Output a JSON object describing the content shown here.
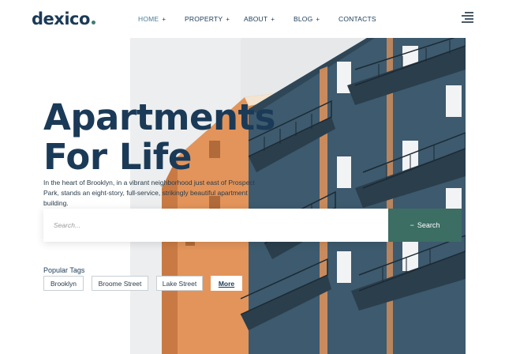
{
  "header": {
    "logo": "dexico",
    "nav": [
      {
        "label": "HOME",
        "has_submenu": true,
        "active": true
      },
      {
        "label": "PROPERTY",
        "has_submenu": true
      },
      {
        "label": "ABOUT",
        "has_submenu": true
      },
      {
        "label": "BLOG",
        "has_submenu": true
      },
      {
        "label": "CONTACTS",
        "has_submenu": false
      }
    ],
    "menu_icon": "hamburger-menu-icon",
    "submenu_marker": "+"
  },
  "hero": {
    "headline_line1": "Apartments",
    "headline_line2": "For Life",
    "description": "In the heart of Brooklyn, in a vibrant neighborhood just east of Prospect Park, stands an eight-story, full-service, strikingly beautiful apartment building."
  },
  "search": {
    "placeholder": "Search...",
    "value": "",
    "button_label": "Search",
    "button_icon": "minus-icon"
  },
  "tags": {
    "label": "Popular Tags",
    "items": [
      "Brooklyn",
      "Broome Street",
      "Lake Street"
    ],
    "more_label": "More"
  },
  "colors": {
    "brand": "#1b3a57",
    "accent": "#3c6e64",
    "nav_active": "#4a7c96",
    "building_blue": "#3d5a6e",
    "building_orange": "#e2945a"
  }
}
